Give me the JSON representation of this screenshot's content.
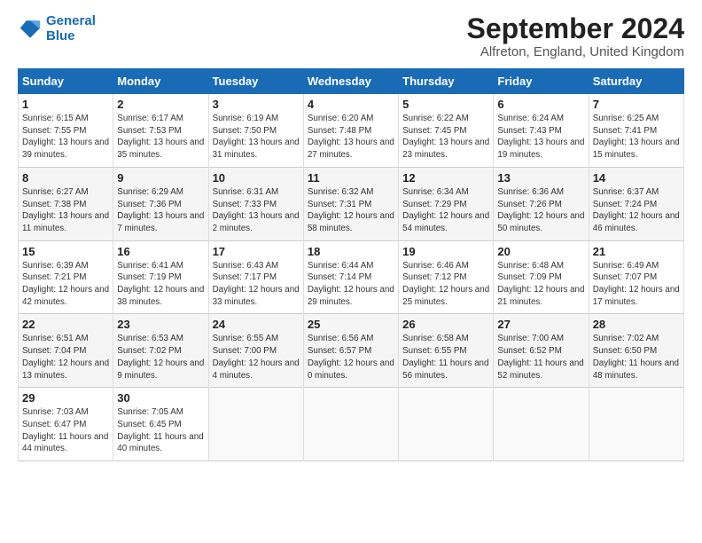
{
  "logo": {
    "line1": "General",
    "line2": "Blue"
  },
  "title": "September 2024",
  "location": "Alfreton, England, United Kingdom",
  "days_of_week": [
    "Sunday",
    "Monday",
    "Tuesday",
    "Wednesday",
    "Thursday",
    "Friday",
    "Saturday"
  ],
  "weeks": [
    [
      {
        "num": "1",
        "sunrise": "6:15 AM",
        "sunset": "7:55 PM",
        "daylight": "13 hours and 39 minutes."
      },
      {
        "num": "2",
        "sunrise": "6:17 AM",
        "sunset": "7:53 PM",
        "daylight": "13 hours and 35 minutes."
      },
      {
        "num": "3",
        "sunrise": "6:19 AM",
        "sunset": "7:50 PM",
        "daylight": "13 hours and 31 minutes."
      },
      {
        "num": "4",
        "sunrise": "6:20 AM",
        "sunset": "7:48 PM",
        "daylight": "13 hours and 27 minutes."
      },
      {
        "num": "5",
        "sunrise": "6:22 AM",
        "sunset": "7:45 PM",
        "daylight": "13 hours and 23 minutes."
      },
      {
        "num": "6",
        "sunrise": "6:24 AM",
        "sunset": "7:43 PM",
        "daylight": "13 hours and 19 minutes."
      },
      {
        "num": "7",
        "sunrise": "6:25 AM",
        "sunset": "7:41 PM",
        "daylight": "13 hours and 15 minutes."
      }
    ],
    [
      {
        "num": "8",
        "sunrise": "6:27 AM",
        "sunset": "7:38 PM",
        "daylight": "13 hours and 11 minutes."
      },
      {
        "num": "9",
        "sunrise": "6:29 AM",
        "sunset": "7:36 PM",
        "daylight": "13 hours and 7 minutes."
      },
      {
        "num": "10",
        "sunrise": "6:31 AM",
        "sunset": "7:33 PM",
        "daylight": "13 hours and 2 minutes."
      },
      {
        "num": "11",
        "sunrise": "6:32 AM",
        "sunset": "7:31 PM",
        "daylight": "12 hours and 58 minutes."
      },
      {
        "num": "12",
        "sunrise": "6:34 AM",
        "sunset": "7:29 PM",
        "daylight": "12 hours and 54 minutes."
      },
      {
        "num": "13",
        "sunrise": "6:36 AM",
        "sunset": "7:26 PM",
        "daylight": "12 hours and 50 minutes."
      },
      {
        "num": "14",
        "sunrise": "6:37 AM",
        "sunset": "7:24 PM",
        "daylight": "12 hours and 46 minutes."
      }
    ],
    [
      {
        "num": "15",
        "sunrise": "6:39 AM",
        "sunset": "7:21 PM",
        "daylight": "12 hours and 42 minutes."
      },
      {
        "num": "16",
        "sunrise": "6:41 AM",
        "sunset": "7:19 PM",
        "daylight": "12 hours and 38 minutes."
      },
      {
        "num": "17",
        "sunrise": "6:43 AM",
        "sunset": "7:17 PM",
        "daylight": "12 hours and 33 minutes."
      },
      {
        "num": "18",
        "sunrise": "6:44 AM",
        "sunset": "7:14 PM",
        "daylight": "12 hours and 29 minutes."
      },
      {
        "num": "19",
        "sunrise": "6:46 AM",
        "sunset": "7:12 PM",
        "daylight": "12 hours and 25 minutes."
      },
      {
        "num": "20",
        "sunrise": "6:48 AM",
        "sunset": "7:09 PM",
        "daylight": "12 hours and 21 minutes."
      },
      {
        "num": "21",
        "sunrise": "6:49 AM",
        "sunset": "7:07 PM",
        "daylight": "12 hours and 17 minutes."
      }
    ],
    [
      {
        "num": "22",
        "sunrise": "6:51 AM",
        "sunset": "7:04 PM",
        "daylight": "12 hours and 13 minutes."
      },
      {
        "num": "23",
        "sunrise": "6:53 AM",
        "sunset": "7:02 PM",
        "daylight": "12 hours and 9 minutes."
      },
      {
        "num": "24",
        "sunrise": "6:55 AM",
        "sunset": "7:00 PM",
        "daylight": "12 hours and 4 minutes."
      },
      {
        "num": "25",
        "sunrise": "6:56 AM",
        "sunset": "6:57 PM",
        "daylight": "12 hours and 0 minutes."
      },
      {
        "num": "26",
        "sunrise": "6:58 AM",
        "sunset": "6:55 PM",
        "daylight": "11 hours and 56 minutes."
      },
      {
        "num": "27",
        "sunrise": "7:00 AM",
        "sunset": "6:52 PM",
        "daylight": "11 hours and 52 minutes."
      },
      {
        "num": "28",
        "sunrise": "7:02 AM",
        "sunset": "6:50 PM",
        "daylight": "11 hours and 48 minutes."
      }
    ],
    [
      {
        "num": "29",
        "sunrise": "7:03 AM",
        "sunset": "6:47 PM",
        "daylight": "11 hours and 44 minutes."
      },
      {
        "num": "30",
        "sunrise": "7:05 AM",
        "sunset": "6:45 PM",
        "daylight": "11 hours and 40 minutes."
      },
      null,
      null,
      null,
      null,
      null
    ]
  ]
}
